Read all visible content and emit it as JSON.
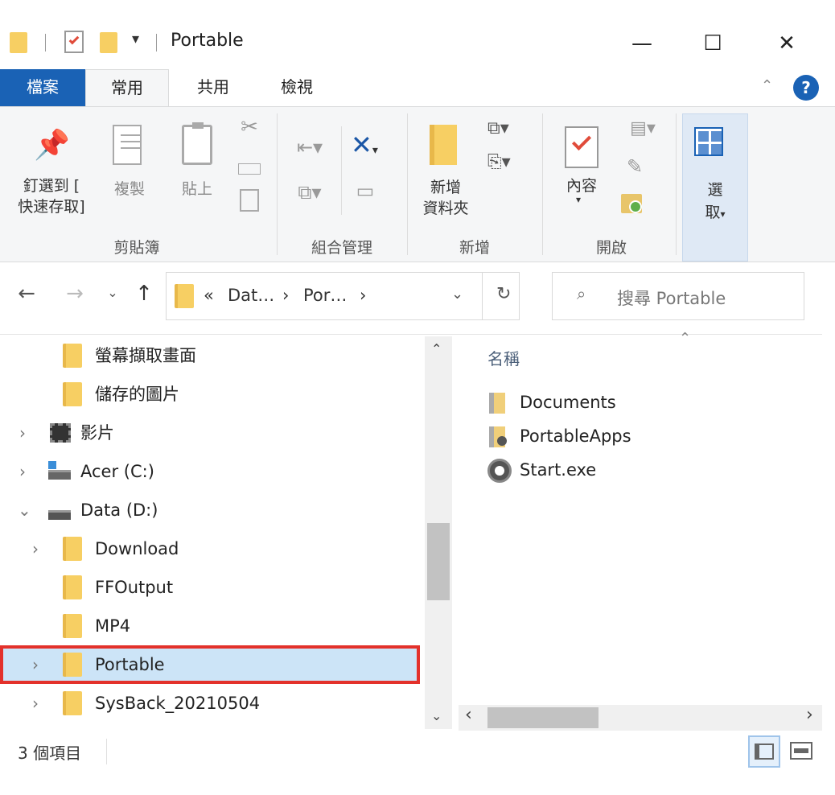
{
  "window": {
    "title": "Portable",
    "minimize_glyph": "—",
    "maximize_glyph": "☐",
    "close_glyph": "✕"
  },
  "tabs": {
    "file": "檔案",
    "home": "常用",
    "share": "共用",
    "view": "檢視"
  },
  "ribbon": {
    "pin_label_1": "釘選到 [",
    "pin_label_2": "快速存取]",
    "copy": "複製",
    "paste": "貼上",
    "clipboard_group": "剪貼簿",
    "organize_group": "組合管理",
    "new_folder_1": "新增",
    "new_folder_2": "資料夾",
    "new_group": "新增",
    "properties": "內容",
    "open_group": "開啟",
    "select_1": "選",
    "select_2": "取"
  },
  "address": {
    "crumbs": [
      "«",
      "Dat…",
      "›",
      "Por…",
      "›"
    ],
    "search_placeholder": "搜尋 Portable"
  },
  "tree": [
    {
      "label": "螢幕擷取畫面",
      "icon": "folder-icon"
    },
    {
      "label": "儲存的圖片",
      "icon": "folder-icon"
    },
    {
      "label": "影片",
      "icon": "video-folder-icon"
    },
    {
      "label": "Acer (C:)",
      "icon": "drive-c-icon"
    },
    {
      "label": "Data (D:)",
      "icon": "drive-icon"
    },
    {
      "label": "Download",
      "icon": "folder-icon"
    },
    {
      "label": "FFOutput",
      "icon": "folder-icon"
    },
    {
      "label": "MP4",
      "icon": "folder-icon"
    },
    {
      "label": "Portable",
      "icon": "folder-icon"
    },
    {
      "label": "SysBack_20210504",
      "icon": "folder-icon"
    }
  ],
  "filelist": {
    "column_name": "名稱",
    "items": [
      {
        "name": "Documents",
        "icon": "documents-folder-icon"
      },
      {
        "name": "PortableApps",
        "icon": "apps-folder-icon"
      },
      {
        "name": "Start.exe",
        "icon": "exe-icon"
      }
    ]
  },
  "status": {
    "count": "3 個項目"
  },
  "colors": {
    "accent": "#1a62b5",
    "folder": "#f7cf63",
    "selection": "#cce4f7",
    "highlight_border": "#e3312b"
  }
}
